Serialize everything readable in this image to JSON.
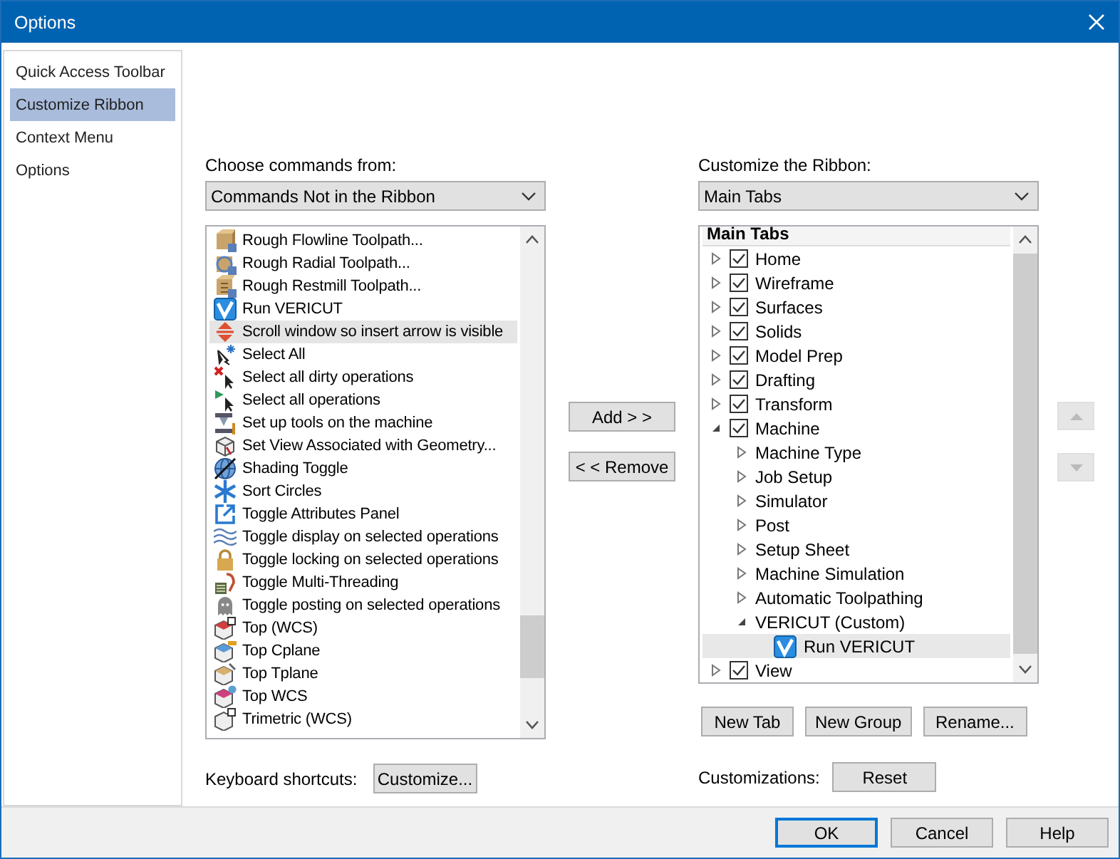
{
  "window": {
    "title": "Options"
  },
  "sidebar": {
    "items": [
      {
        "label": "Quick Access Toolbar",
        "selected": false
      },
      {
        "label": "Customize Ribbon",
        "selected": true
      },
      {
        "label": "Context Menu",
        "selected": false
      },
      {
        "label": "Options",
        "selected": false
      }
    ]
  },
  "commands": {
    "label": "Choose commands from:",
    "source": "Commands Not in the Ribbon",
    "items": [
      {
        "label": "Rough Flowline Toolpath...",
        "selected": false
      },
      {
        "label": "Rough Radial Toolpath...",
        "selected": false
      },
      {
        "label": "Rough Restmill Toolpath...",
        "selected": false
      },
      {
        "label": "Run VERICUT",
        "selected": false
      },
      {
        "label": "Scroll window so insert arrow is visible",
        "selected": true
      },
      {
        "label": "Select All",
        "selected": false
      },
      {
        "label": "Select all dirty operations",
        "selected": false
      },
      {
        "label": "Select all operations",
        "selected": false
      },
      {
        "label": "Set up tools on the machine",
        "selected": false
      },
      {
        "label": "Set View Associated with Geometry...",
        "selected": false
      },
      {
        "label": "Shading Toggle",
        "selected": false
      },
      {
        "label": "Sort Circles",
        "selected": false
      },
      {
        "label": "Toggle Attributes Panel",
        "selected": false
      },
      {
        "label": "Toggle display on selected operations",
        "selected": false
      },
      {
        "label": "Toggle locking on selected operations",
        "selected": false
      },
      {
        "label": "Toggle Multi-Threading",
        "selected": false
      },
      {
        "label": "Toggle posting on selected operations",
        "selected": false
      },
      {
        "label": "Top (WCS)",
        "selected": false
      },
      {
        "label": "Top Cplane",
        "selected": false
      },
      {
        "label": "Top Tplane",
        "selected": false
      },
      {
        "label": "Top WCS",
        "selected": false
      },
      {
        "label": "Trimetric (WCS)",
        "selected": false
      }
    ]
  },
  "add_button": "Add > >",
  "remove_button": "< < Remove",
  "ribbon": {
    "label": "Customize the Ribbon:",
    "source": "Main Tabs",
    "header": "Main Tabs",
    "tree": [
      {
        "kind": "tab",
        "label": "Home",
        "checked": true,
        "expanded": false,
        "selected": false
      },
      {
        "kind": "tab",
        "label": "Wireframe",
        "checked": true,
        "expanded": false,
        "selected": false
      },
      {
        "kind": "tab",
        "label": "Surfaces",
        "checked": true,
        "expanded": false,
        "selected": false
      },
      {
        "kind": "tab",
        "label": "Solids",
        "checked": true,
        "expanded": false,
        "selected": false
      },
      {
        "kind": "tab",
        "label": "Model Prep",
        "checked": true,
        "expanded": false,
        "selected": false
      },
      {
        "kind": "tab",
        "label": "Drafting",
        "checked": true,
        "expanded": false,
        "selected": false
      },
      {
        "kind": "tab",
        "label": "Transform",
        "checked": true,
        "expanded": false,
        "selected": false
      },
      {
        "kind": "tab",
        "label": "Machine",
        "checked": true,
        "expanded": true,
        "selected": false,
        "children": [
          {
            "kind": "group",
            "label": "Machine Type",
            "expanded": false,
            "selected": false
          },
          {
            "kind": "group",
            "label": "Job Setup",
            "expanded": false,
            "selected": false
          },
          {
            "kind": "group",
            "label": "Simulator",
            "expanded": false,
            "selected": false
          },
          {
            "kind": "group",
            "label": "Post",
            "expanded": false,
            "selected": false
          },
          {
            "kind": "group",
            "label": "Setup Sheet",
            "expanded": false,
            "selected": false
          },
          {
            "kind": "group",
            "label": "Machine Simulation",
            "expanded": false,
            "selected": false
          },
          {
            "kind": "group",
            "label": "Automatic Toolpathing",
            "expanded": false,
            "selected": false
          },
          {
            "kind": "group",
            "label": "VERICUT (Custom)",
            "expanded": true,
            "selected": false,
            "children": [
              {
                "kind": "command",
                "label": "Run VERICUT",
                "selected": true
              }
            ]
          }
        ]
      },
      {
        "kind": "tab",
        "label": "View",
        "checked": true,
        "expanded": false,
        "selected": false
      }
    ]
  },
  "move_up": {
    "disabled": true
  },
  "move_down": {
    "disabled": true
  },
  "tree_buttons": [
    "New Tab",
    "New Group",
    "Rename..."
  ],
  "keyboard": {
    "label": "Keyboard shortcuts:",
    "button": "Customize..."
  },
  "customizations": {
    "label": "Customizations:",
    "button": "Reset"
  },
  "footer": [
    {
      "label": "OK",
      "default": true
    },
    {
      "label": "Cancel",
      "default": false
    },
    {
      "label": "Help",
      "default": false
    }
  ]
}
